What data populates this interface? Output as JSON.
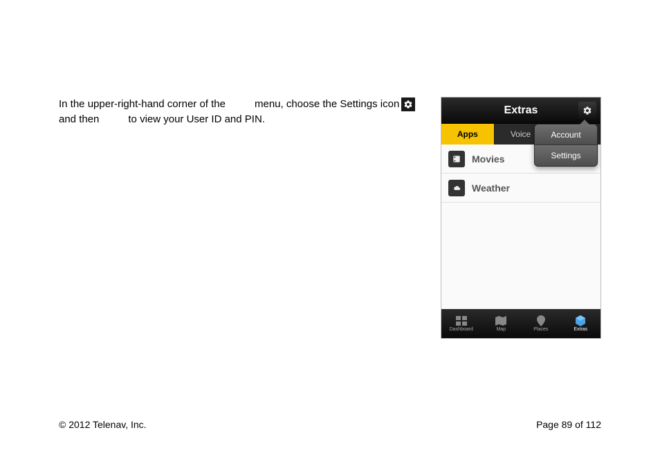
{
  "body": {
    "line1_a": "In the upper-right-hand corner of the ",
    "line1_b": " menu, choose the Settings icon",
    "line2_a": "and then ",
    "line2_b": " to view your User ID and PIN."
  },
  "phone": {
    "header_title": "Extras",
    "tabs": {
      "active": "Apps",
      "second": "Voice"
    },
    "dropdown": {
      "item1": "Account",
      "item2": "Settings"
    },
    "list": {
      "item1": "Movies",
      "item2": "Weather"
    },
    "nav": {
      "i1": "Dashboard",
      "i2": "Map",
      "i3": "Places",
      "i4": "Extras"
    }
  },
  "footer": {
    "copyright": "© 2012 Telenav, Inc.",
    "page": "Page 89 of 112"
  }
}
